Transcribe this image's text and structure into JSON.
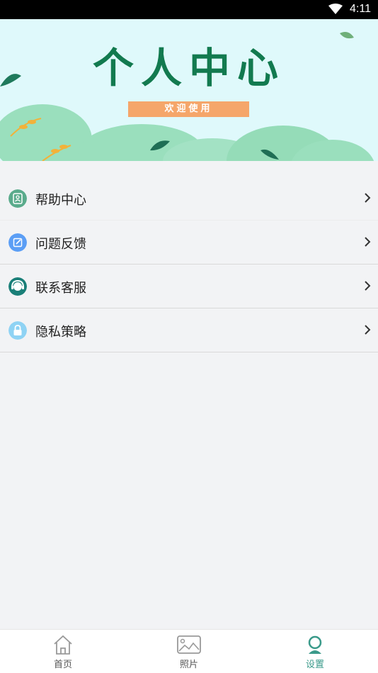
{
  "status_bar": {
    "time": "4:11"
  },
  "banner": {
    "title": "个人中心",
    "subtitle": "欢迎使用"
  },
  "menu": {
    "items": [
      {
        "label": "帮助中心",
        "icon": "help-center-icon",
        "color": "#5aab8c"
      },
      {
        "label": "问题反馈",
        "icon": "feedback-edit-icon",
        "color": "#5b9ef5"
      },
      {
        "label": "联系客服",
        "icon": "customer-service-icon",
        "color": "#1a7f78"
      },
      {
        "label": "隐私策略",
        "icon": "lock-icon",
        "color": "#8fd3f4"
      }
    ]
  },
  "tabbar": {
    "tabs": [
      {
        "label": "首页",
        "icon": "home-icon",
        "active": false
      },
      {
        "label": "照片",
        "icon": "photo-icon",
        "active": false
      },
      {
        "label": "设置",
        "icon": "settings-user-icon",
        "active": true
      }
    ]
  },
  "colors": {
    "accent": "#3a9a8a",
    "banner_bg": "#dff9fb",
    "title_green": "#127a4f",
    "subtitle_bg": "#f5a66a"
  }
}
